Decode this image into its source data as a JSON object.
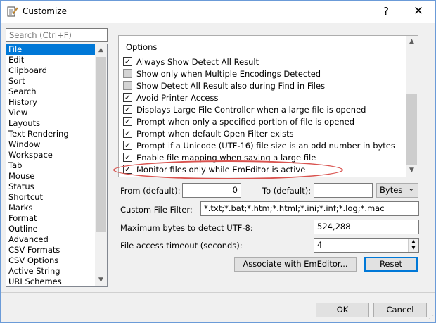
{
  "window": {
    "title": "Customize",
    "help_glyph": "?",
    "close_glyph": "✕",
    "icon": "notepad-pencil-icon"
  },
  "search": {
    "placeholder": "Search (Ctrl+F)"
  },
  "categories": [
    {
      "label": "File",
      "selected": true
    },
    {
      "label": "Edit"
    },
    {
      "label": "Clipboard"
    },
    {
      "label": "Sort"
    },
    {
      "label": "Search"
    },
    {
      "label": "History"
    },
    {
      "label": "View"
    },
    {
      "label": "Layouts"
    },
    {
      "label": "Text Rendering"
    },
    {
      "label": "Window"
    },
    {
      "label": "Workspace"
    },
    {
      "label": "Tab"
    },
    {
      "label": "Mouse"
    },
    {
      "label": "Status"
    },
    {
      "label": "Shortcut"
    },
    {
      "label": "Marks"
    },
    {
      "label": "Format"
    },
    {
      "label": "Outline"
    },
    {
      "label": "Advanced"
    },
    {
      "label": "CSV Formats"
    },
    {
      "label": "CSV Options"
    },
    {
      "label": "Active String"
    },
    {
      "label": "URI Schemes"
    }
  ],
  "options": {
    "title": "Options",
    "items": [
      {
        "label": "Always Show Detect All Result",
        "checked": true
      },
      {
        "label": "Show only when Multiple Encodings Detected",
        "checked": false
      },
      {
        "label": "Show Detect All Result also during Find in Files",
        "checked": false
      },
      {
        "label": "Avoid Printer Access",
        "checked": true
      },
      {
        "label": "Displays Large File Controller when a large file is opened",
        "checked": true
      },
      {
        "label": "Prompt when only a specified portion of file is opened",
        "checked": true
      },
      {
        "label": "Prompt when default Open Filter exists",
        "checked": true
      },
      {
        "label": "Prompt if a Unicode (UTF-16) file size is an odd number in bytes",
        "checked": true
      },
      {
        "label": "Enable file mapping when saving a large file",
        "checked": true
      },
      {
        "label": "Monitor files only while EmEditor is active",
        "checked": true
      }
    ],
    "highlight_color": "#d9534f"
  },
  "range": {
    "from_label": "From (default):",
    "from_value": "0",
    "to_label": "To (default):",
    "to_value": "",
    "unit_value": "Bytes"
  },
  "filter": {
    "label": "Custom File Filter:",
    "value": "*.txt;*.bat;*.htm;*.html;*.ini;*.inf;*.log;*.mac"
  },
  "utf8": {
    "label": "Maximum bytes to detect UTF-8:",
    "value": "524,288"
  },
  "timeout": {
    "label": "File access timeout (seconds):",
    "value": "4"
  },
  "buttons": {
    "associate": "Associate with EmEditor...",
    "reset": "Reset",
    "ok": "OK",
    "cancel": "Cancel"
  },
  "colors": {
    "selection": "#0078d7",
    "default_button_border": "#0078d7"
  }
}
